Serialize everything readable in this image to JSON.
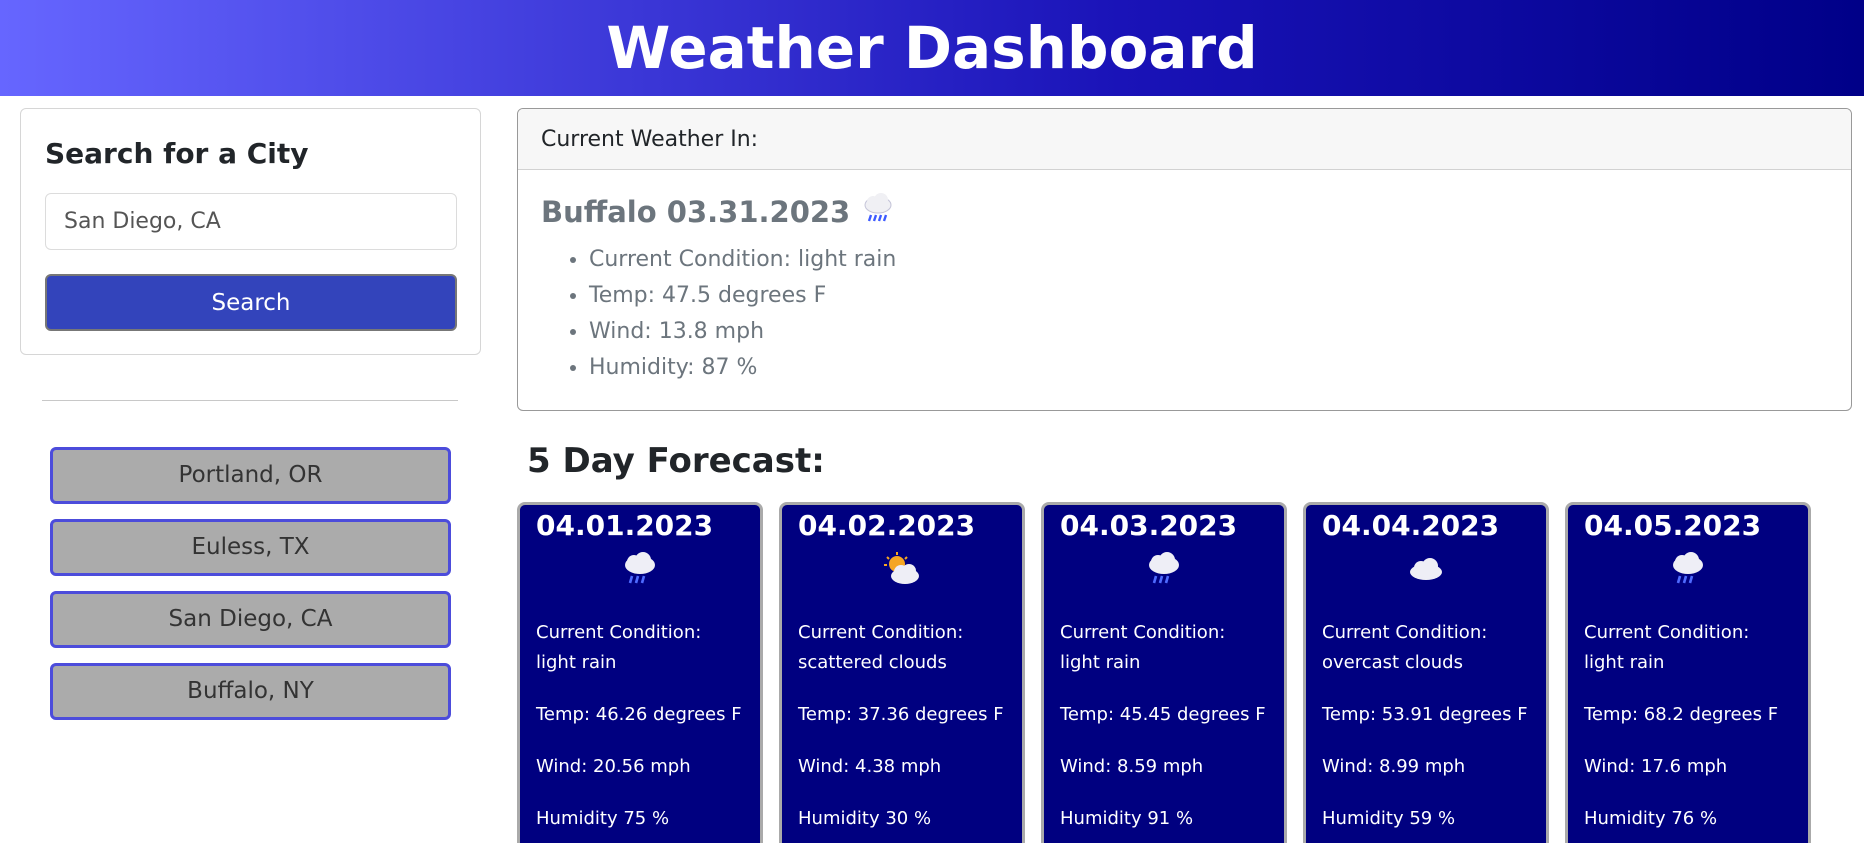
{
  "header": {
    "title": "Weather Dashboard"
  },
  "search": {
    "title": "Search for a City",
    "input_value": "San Diego, CA",
    "button_label": "Search"
  },
  "history": [
    {
      "label": "Portland, OR"
    },
    {
      "label": "Euless, TX"
    },
    {
      "label": "San Diego, CA"
    },
    {
      "label": "Buffalo, NY"
    }
  ],
  "current": {
    "header_label": "Current Weather In:",
    "city_date": "Buffalo 03.31.2023",
    "icon": "rain-cloud-icon",
    "condition": "Current Condition: light rain",
    "temp": "Temp: 47.5 degrees F",
    "wind": "Wind: 13.8 mph",
    "humidity": "Humidity: 87 %"
  },
  "forecast": {
    "title": "5 Day Forecast:",
    "days": [
      {
        "date": "04.01.2023",
        "icon": "rain-cloud-icon",
        "condition": "Current Condition: light rain",
        "temp": "Temp: 46.26 degrees F",
        "wind": "Wind: 20.56 mph",
        "humidity": "Humidity 75 %"
      },
      {
        "date": "04.02.2023",
        "icon": "sun-cloud-icon",
        "condition": "Current Condition: scattered clouds",
        "temp": "Temp: 37.36 degrees F",
        "wind": "Wind: 4.38 mph",
        "humidity": "Humidity 30 %"
      },
      {
        "date": "04.03.2023",
        "icon": "rain-cloud-icon",
        "condition": "Current Condition: light rain",
        "temp": "Temp: 45.45 degrees F",
        "wind": "Wind: 8.59 mph",
        "humidity": "Humidity 91 %"
      },
      {
        "date": "04.04.2023",
        "icon": "cloud-icon",
        "condition": "Current Condition: overcast clouds",
        "temp": "Temp: 53.91 degrees F",
        "wind": "Wind: 8.99 mph",
        "humidity": "Humidity 59 %"
      },
      {
        "date": "04.05.2023",
        "icon": "rain-cloud-icon",
        "condition": "Current Condition: light rain",
        "temp": "Temp: 68.2 degrees F",
        "wind": "Wind: 17.6 mph",
        "humidity": "Humidity 76 %"
      }
    ]
  },
  "colors": {
    "header_gradient_start": "#6666ff",
    "header_gradient_end": "#000088",
    "search_button": "#3344bb",
    "history_button_bg": "#ababab",
    "history_button_border": "#4c4cdb",
    "forecast_card_bg": "#000080"
  }
}
